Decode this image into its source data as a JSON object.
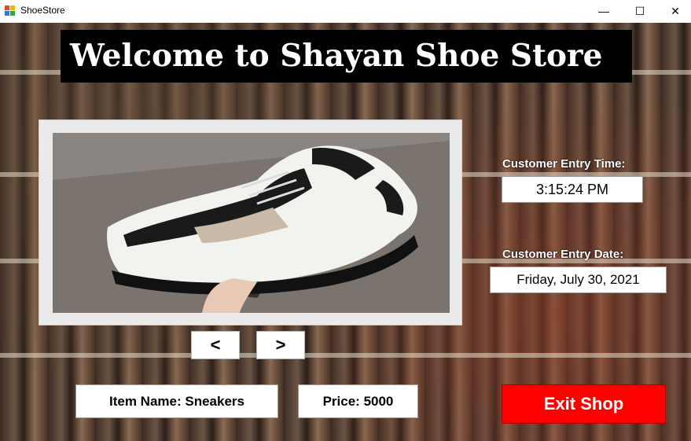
{
  "window": {
    "title": "ShoeStore",
    "minimize_glyph": "—",
    "maximize_glyph": "☐",
    "close_glyph": "✕"
  },
  "banner": {
    "title": "Welcome to Shayan Shoe Store"
  },
  "product": {
    "image_icon": "sneaker-photo",
    "prev_label": "<",
    "next_label": ">",
    "item_name": "Item Name: Sneakers",
    "price": "Price: 5000"
  },
  "entry": {
    "time_label": "Customer Entry Time:",
    "time_value": "3:15:24 PM",
    "date_label": "Customer Entry Date:",
    "date_value": "Friday, July 30, 2021"
  },
  "exit_button_label": "Exit Shop",
  "colors": {
    "exit_button": "#ff0000",
    "banner_bg": "#000000"
  }
}
